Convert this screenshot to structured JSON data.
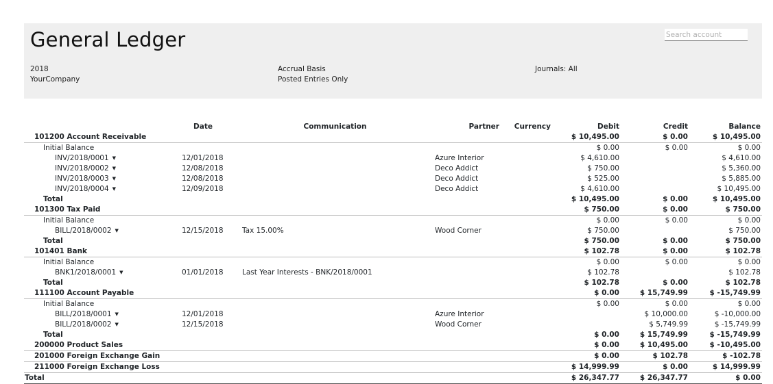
{
  "header": {
    "title": "General Ledger",
    "search_placeholder": "Search account",
    "year": "2018",
    "company": "YourCompany",
    "basis": "Accrual Basis",
    "entries": "Posted Entries Only",
    "journals": "Journals: All"
  },
  "columns": [
    "",
    "Date",
    "Communication",
    "Partner",
    "Currency",
    "Debit",
    "Credit",
    "Balance"
  ],
  "rows": [
    {
      "type": "account",
      "label": "101200 Account Receivable",
      "debit": "$ 10,495.00",
      "credit": "$ 0.00",
      "balance": "$ 10,495.00"
    },
    {
      "type": "initial",
      "label": "Initial Balance",
      "debit": "$ 0.00",
      "credit": "$ 0.00",
      "balance": "$ 0.00"
    },
    {
      "type": "line",
      "label": "INV/2018/0001",
      "date": "12/01/2018",
      "comm": "",
      "partner": "Azure Interior",
      "debit": "$ 4,610.00",
      "credit": "",
      "balance": "$ 4,610.00"
    },
    {
      "type": "line",
      "label": "INV/2018/0002",
      "date": "12/08/2018",
      "comm": "",
      "partner": "Deco Addict",
      "debit": "$ 750.00",
      "credit": "",
      "balance": "$ 5,360.00"
    },
    {
      "type": "line",
      "label": "INV/2018/0003",
      "date": "12/08/2018",
      "comm": "",
      "partner": "Deco Addict",
      "debit": "$ 525.00",
      "credit": "",
      "balance": "$ 5,885.00"
    },
    {
      "type": "line",
      "label": "INV/2018/0004",
      "date": "12/09/2018",
      "comm": "",
      "partner": "Deco Addict",
      "debit": "$ 4,610.00",
      "credit": "",
      "balance": "$ 10,495.00"
    },
    {
      "type": "total",
      "label": "Total",
      "debit": "$ 10,495.00",
      "credit": "$ 0.00",
      "balance": "$ 10,495.00"
    },
    {
      "type": "account",
      "label": "101300 Tax Paid",
      "debit": "$ 750.00",
      "credit": "$ 0.00",
      "balance": "$ 750.00"
    },
    {
      "type": "initial",
      "label": "Initial Balance",
      "debit": "$ 0.00",
      "credit": "$ 0.00",
      "balance": "$ 0.00"
    },
    {
      "type": "line",
      "label": "BILL/2018/0002",
      "date": "12/15/2018",
      "comm": "Tax 15.00%",
      "partner": "Wood Corner",
      "debit": "$ 750.00",
      "credit": "",
      "balance": "$ 750.00"
    },
    {
      "type": "total",
      "label": "Total",
      "debit": "$ 750.00",
      "credit": "$ 0.00",
      "balance": "$ 750.00"
    },
    {
      "type": "account",
      "label": "101401 Bank",
      "debit": "$ 102.78",
      "credit": "$ 0.00",
      "balance": "$ 102.78"
    },
    {
      "type": "initial",
      "label": "Initial Balance",
      "debit": "$ 0.00",
      "credit": "$ 0.00",
      "balance": "$ 0.00"
    },
    {
      "type": "line",
      "label": "BNK1/2018/0001",
      "date": "01/01/2018",
      "comm": "Last Year Interests - BNK/2018/0001",
      "partner": "",
      "debit": "$ 102.78",
      "credit": "",
      "balance": "$ 102.78"
    },
    {
      "type": "total",
      "label": "Total",
      "debit": "$ 102.78",
      "credit": "$ 0.00",
      "balance": "$ 102.78"
    },
    {
      "type": "account",
      "label": "111100 Account Payable",
      "debit": "$ 0.00",
      "credit": "$ 15,749.99",
      "balance": "$ -15,749.99"
    },
    {
      "type": "initial",
      "label": "Initial Balance",
      "debit": "$ 0.00",
      "credit": "$ 0.00",
      "balance": "$ 0.00"
    },
    {
      "type": "line",
      "label": "BILL/2018/0001",
      "date": "12/01/2018",
      "comm": "",
      "partner": "Azure Interior",
      "debit": "",
      "credit": "$ 10,000.00",
      "balance": "$ -10,000.00"
    },
    {
      "type": "line",
      "label": "BILL/2018/0002",
      "date": "12/15/2018",
      "comm": "",
      "partner": "Wood Corner",
      "debit": "",
      "credit": "$ 5,749.99",
      "balance": "$ -15,749.99"
    },
    {
      "type": "total",
      "label": "Total",
      "debit": "$ 0.00",
      "credit": "$ 15,749.99",
      "balance": "$ -15,749.99"
    },
    {
      "type": "account",
      "label": "200000 Product Sales",
      "debit": "$ 0.00",
      "credit": "$ 10,495.00",
      "balance": "$ -10,495.00"
    },
    {
      "type": "account",
      "label": "201000 Foreign Exchange Gain",
      "debit": "$ 0.00",
      "credit": "$ 102.78",
      "balance": "$ -102.78"
    },
    {
      "type": "account",
      "label": "211000 Foreign Exchange Loss",
      "debit": "$ 14,999.99",
      "credit": "$ 0.00",
      "balance": "$ 14,999.99"
    },
    {
      "type": "grand",
      "label": "Total",
      "debit": "$ 26,347.77",
      "credit": "$ 26,347.77",
      "balance": "$ 0.00"
    }
  ]
}
